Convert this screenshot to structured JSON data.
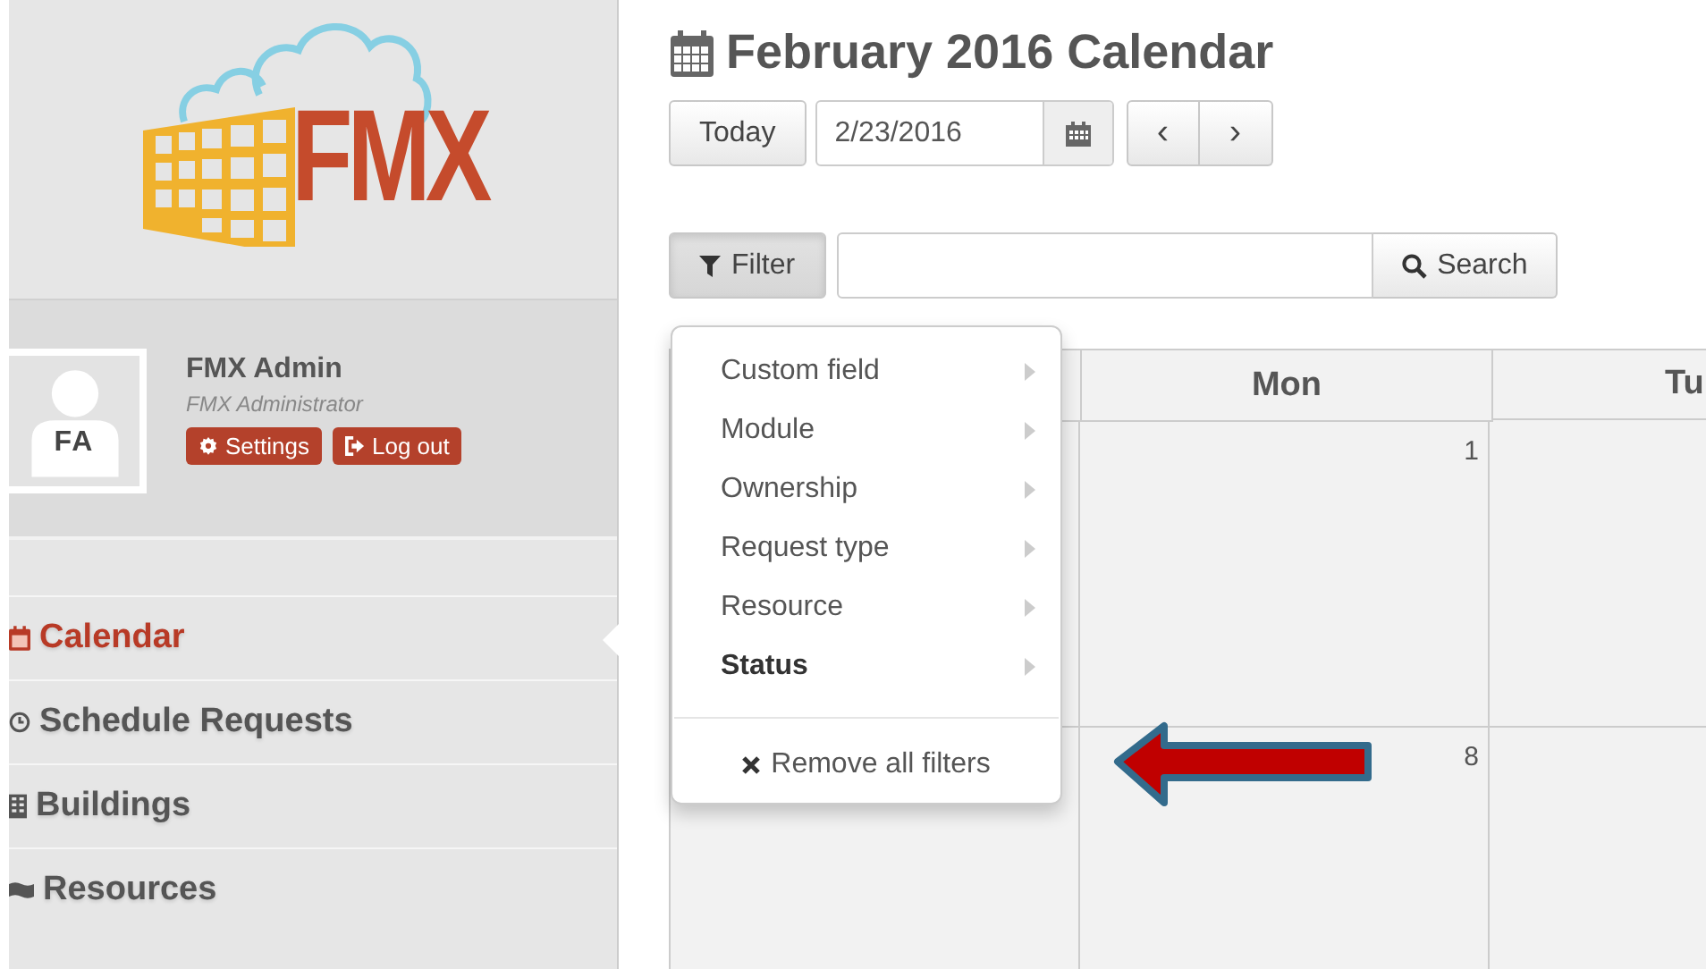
{
  "logo": {
    "text": "FMX"
  },
  "user": {
    "initials": "FA",
    "name": "FMX Admin",
    "role": "FMX Administrator",
    "buttons": [
      {
        "label": "Settings",
        "kind": "settings"
      },
      {
        "label": "Log out",
        "kind": "logout"
      }
    ]
  },
  "sidebar": {
    "items": [
      {
        "label": "Calendar",
        "kind": "calendar",
        "selected": true
      },
      {
        "label": "Schedule Requests",
        "kind": "clock",
        "selected": false
      },
      {
        "label": "Buildings",
        "kind": "building",
        "selected": false
      },
      {
        "label": "Resources",
        "kind": "flag",
        "selected": false
      }
    ]
  },
  "header": {
    "title": "February 2016 Calendar"
  },
  "toolbar": {
    "today": "Today",
    "date": "2/23/2016",
    "prev": "‹",
    "next": "›"
  },
  "filter": {
    "button": "Filter",
    "search_button": "Search",
    "menu": {
      "items": [
        {
          "label": "Custom field",
          "active": false
        },
        {
          "label": "Module",
          "active": false
        },
        {
          "label": "Ownership",
          "active": false
        },
        {
          "label": "Request type",
          "active": false
        },
        {
          "label": "Resource",
          "active": false
        },
        {
          "label": "Status",
          "active": true
        }
      ],
      "remove": "Remove all filters"
    }
  },
  "calendar": {
    "columns": [
      {
        "label": "Mon"
      },
      {
        "label": "Tu"
      }
    ],
    "weeks": [
      {
        "mon": "1"
      },
      {
        "mon": "8"
      }
    ]
  }
}
